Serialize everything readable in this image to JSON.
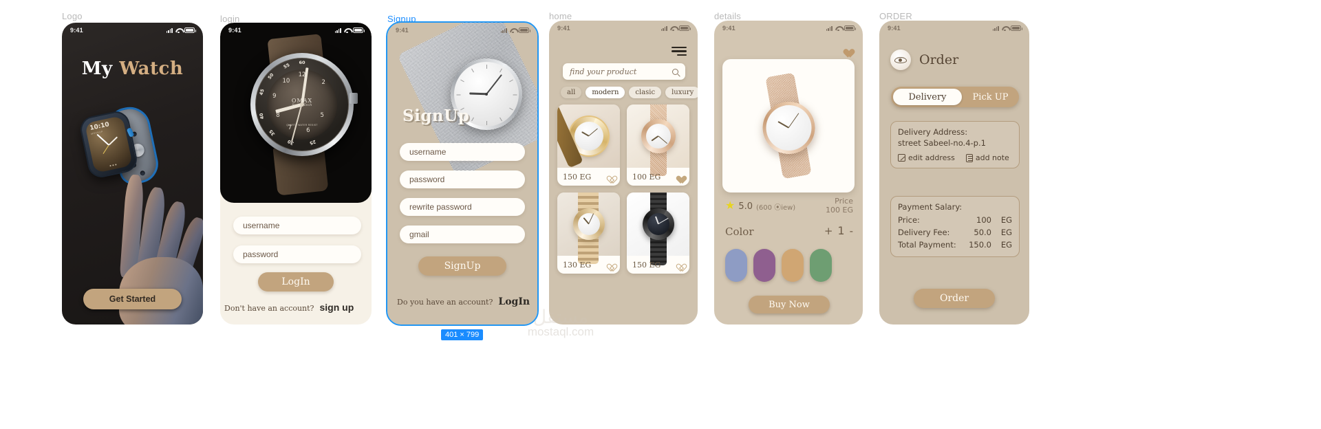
{
  "frames": [
    {
      "label": "Logo"
    },
    {
      "label": "login"
    },
    {
      "label": "Signup"
    },
    {
      "label": "home"
    },
    {
      "label": "details"
    },
    {
      "label": "ORDER"
    }
  ],
  "status_bar": {
    "time": "9:41",
    "signal": "signal-icon",
    "wifi": "wifi-icon",
    "battery": "battery-icon"
  },
  "logo_screen": {
    "title_word1": "My",
    "title_word2": "Watch",
    "watch_time": "10:10",
    "watch_sub": "MOCKUP",
    "cta": "Get Started"
  },
  "login_screen": {
    "username_placeholder": "username",
    "password_placeholder": "password",
    "login_button": "LogIn",
    "footer_text": "Don't have an account?",
    "footer_link": "sign up",
    "watch_brand": "OMAX",
    "watch_brand_sub": "Swiss Tech",
    "watch_caption": "QUARTZ\nWATER RESIST"
  },
  "signup_screen": {
    "title": "SignUp",
    "username_placeholder": "username",
    "password_placeholder": "password",
    "rewrite_placeholder": "rewrite password",
    "email_placeholder": "gmail",
    "signup_button": "SignUp",
    "footer_text": "Do you have an account?",
    "footer_link": "LogIn",
    "selection_size": "401 × 799"
  },
  "home_screen": {
    "menu_icon": "hamburger-menu-icon",
    "search_placeholder": "find your product",
    "search_icon": "search-icon",
    "filters": [
      {
        "label": "all",
        "active": false,
        "style": "ghost"
      },
      {
        "label": "modern",
        "active": true,
        "style": "on"
      },
      {
        "label": "clasic",
        "active": false,
        "style": "plain"
      },
      {
        "label": "luxury",
        "active": false,
        "style": "plain"
      }
    ],
    "products": [
      {
        "price": "150 EG",
        "favorite": false,
        "watch": "gold-crystal"
      },
      {
        "price": "100 EG",
        "favorite": true,
        "watch": "rose-mesh"
      },
      {
        "price": "130 EG",
        "favorite": false,
        "watch": "two-tone"
      },
      {
        "price": "150 EG",
        "favorite": false,
        "watch": "black-steel"
      }
    ]
  },
  "details_screen": {
    "favorite_icon": "heart-icon",
    "rating_star": "star-icon",
    "rating_value": "5.0",
    "rating_views": "(600 ⦿iew)",
    "price_label": "Price",
    "price_value": "100 EG",
    "color_label": "Color",
    "qty_minus": "-",
    "qty_plus": "+",
    "qty_value": "1",
    "colors": [
      "#8e9cc4",
      "#8f5f8f",
      "#d0a673",
      "#6e9e72"
    ],
    "buy_button": "Buy Now"
  },
  "order_screen": {
    "avatar": "user-avatar",
    "title": "Order",
    "tab_delivery": "Delivery",
    "tab_pickup": "Pick UP",
    "address_title": "Delivery Address:",
    "address_line": "street Sabeel-no.4-p.1",
    "edit_address": "edit address",
    "add_note": "add note",
    "payment_title": "Payment Salary:",
    "payment_rows": [
      {
        "label": "Price:",
        "value": "100",
        "currency": "EG"
      },
      {
        "label": "Delivery Fee:",
        "value": "50.0",
        "currency": "EG"
      },
      {
        "label": "Total Payment:",
        "value": "150.0",
        "currency": "EG"
      }
    ],
    "order_button": "Order"
  },
  "watermark": {
    "arabic": "مستقل",
    "latin": "mostaql.com"
  },
  "colors": {
    "accent_tan": "#c2a47e",
    "bg_beige": "#cdc0ac",
    "selection_blue": "#1a8cff",
    "dark": "#211d1c"
  }
}
